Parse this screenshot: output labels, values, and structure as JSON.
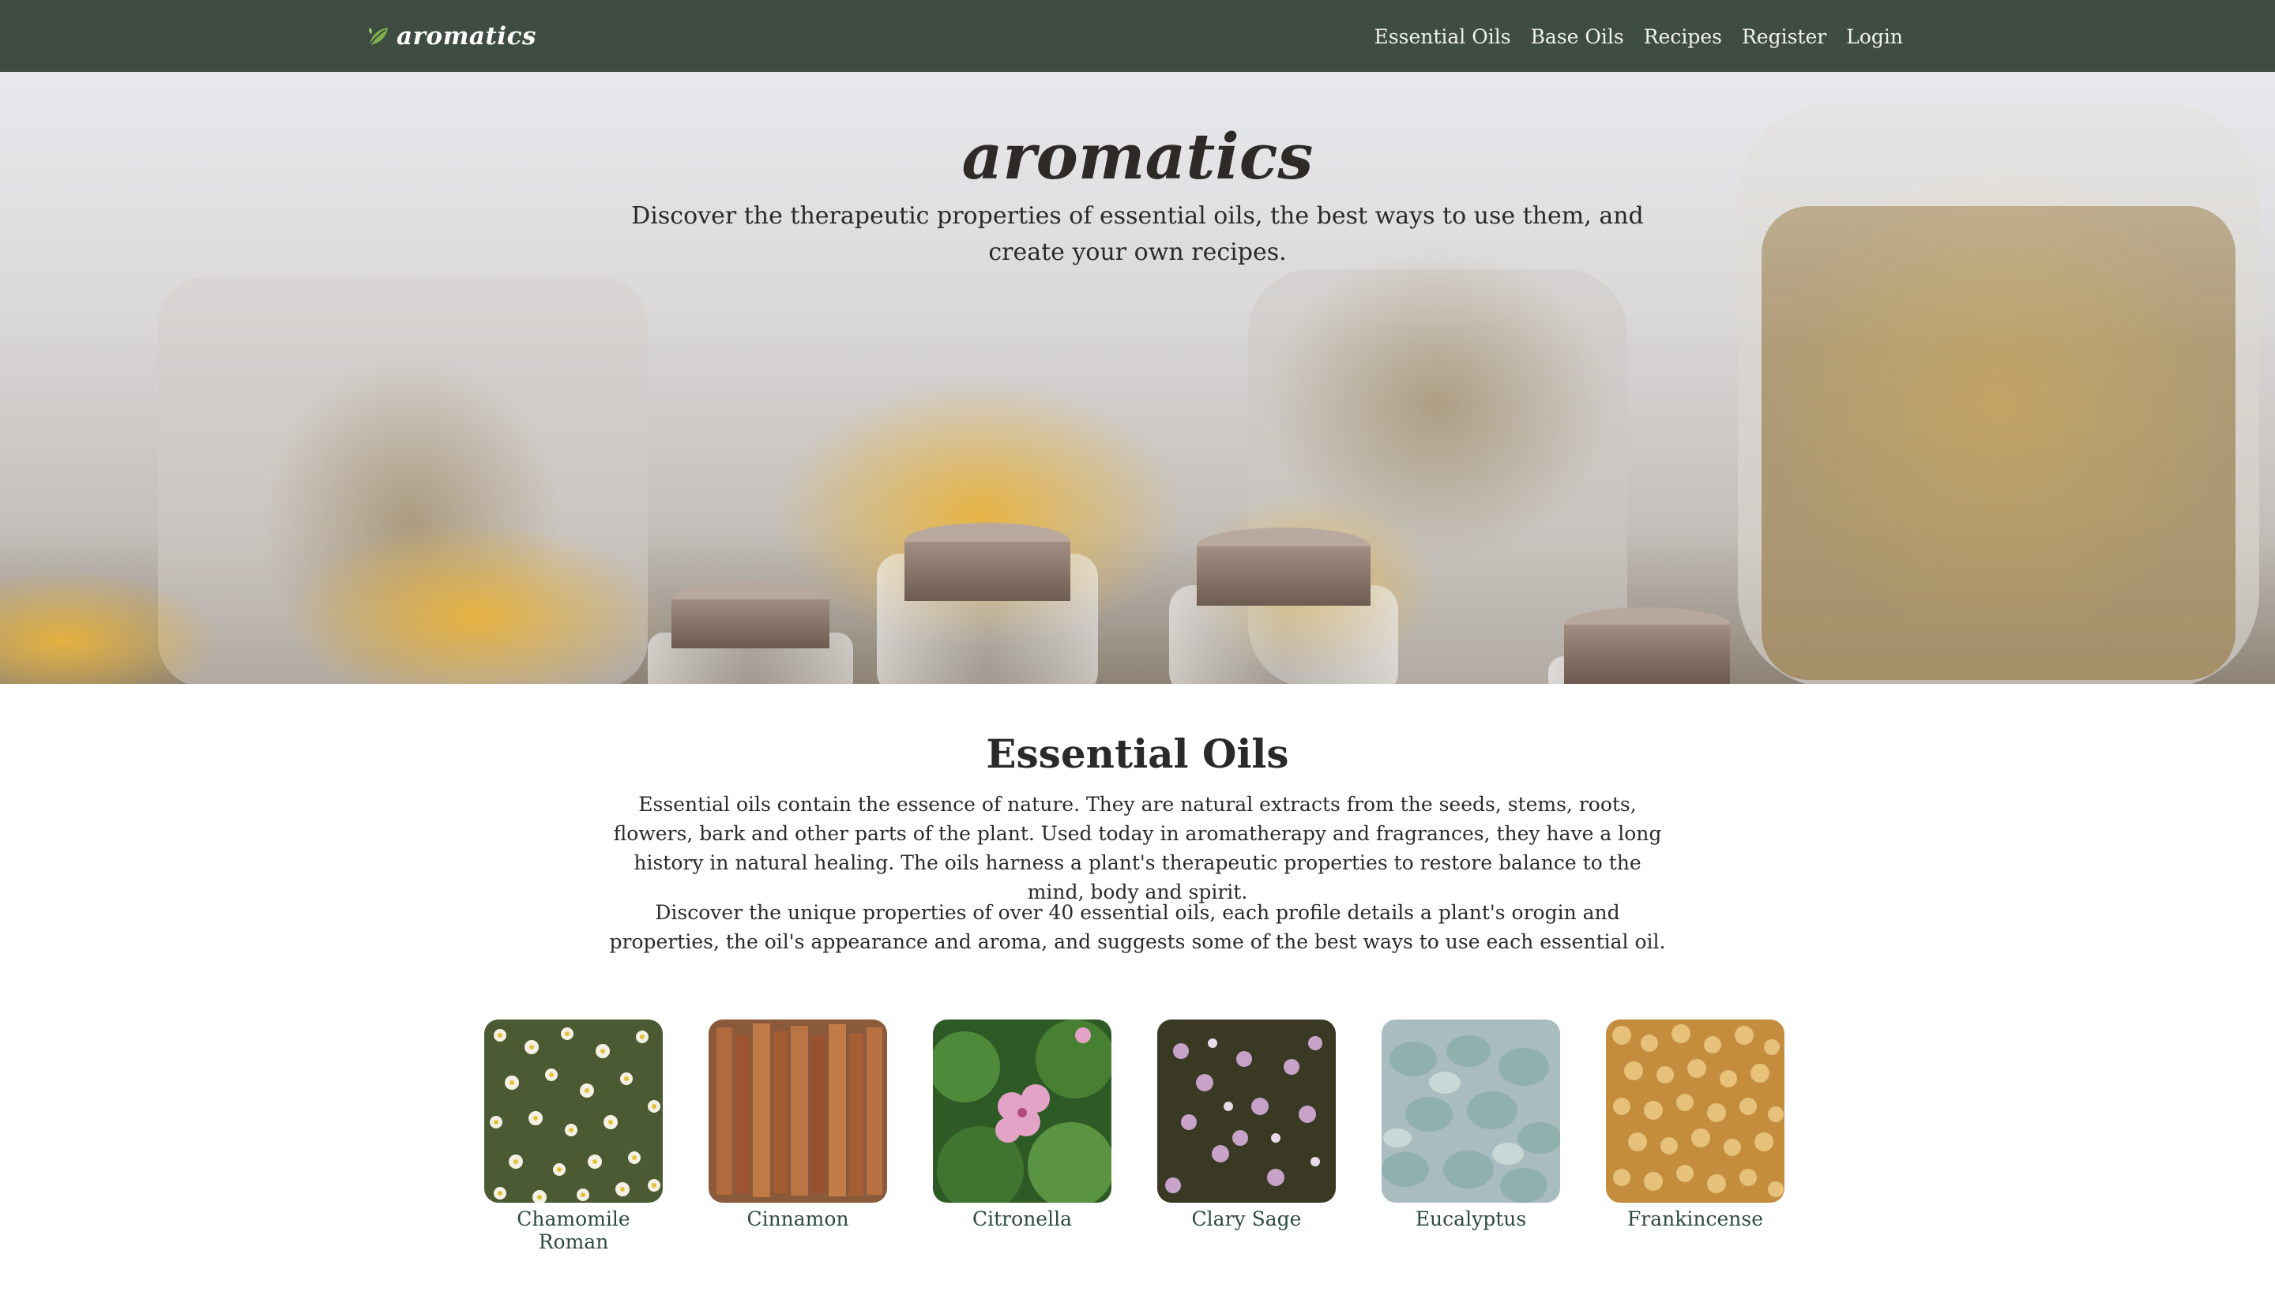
{
  "navbar": {
    "brand": "aromatics",
    "links": [
      "Essential Oils",
      "Base Oils",
      "Recipes",
      "Register",
      "Login"
    ]
  },
  "hero": {
    "title": "aromatics",
    "subtitle": "Discover the therapeutic properties of essential oils, the best ways to use them, and create your own recipes."
  },
  "essential_oils": {
    "title": "Essential Oils",
    "paragraph1": "Essential oils contain the essence of nature. They are natural extracts from the seeds, stems, roots, flowers, bark and other parts of the plant. Used today in aromatherapy and fragrances, they have a long history in natural healing. The oils harness a plant's therapeutic properties to restore balance to the mind, body and spirit.",
    "paragraph2": "Discover the unique properties of over 40 essential oils, each profile details a plant's orogin and properties, the oil's appearance and aroma, and suggests some of the best ways to use each essential oil.",
    "oils": [
      {
        "name": "Chamomile Roman"
      },
      {
        "name": "Cinnamon"
      },
      {
        "name": "Citronella"
      },
      {
        "name": "Clary Sage"
      },
      {
        "name": "Eucalyptus"
      },
      {
        "name": "Frankincense"
      }
    ]
  },
  "colors": {
    "navbar_bg": "#3f4c41",
    "nav_text": "#f1f1ec",
    "oil_label": "#2d4a3f",
    "page_bg": "#ffffff"
  }
}
